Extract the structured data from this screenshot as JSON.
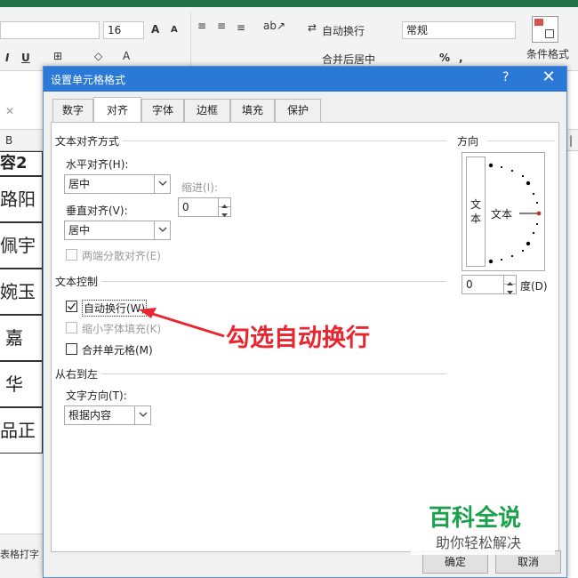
{
  "ribbon": {
    "font_size": "16",
    "wrap_text": "自动换行",
    "number_format": "常规",
    "merge_center": "合并后居中",
    "conditional_format": "条件格式",
    "font_increase": "A",
    "font_decrease": "A",
    "bold": "I",
    "underline": "U",
    "percent": "%",
    "comma": ","
  },
  "sheet": {
    "column_b": "B",
    "header_cell": "容2",
    "cells": [
      "路阳",
      "佩宇",
      "婉玉",
      "嘉",
      "华",
      "品正"
    ],
    "footer_text": "表格打字"
  },
  "dialog": {
    "title": "设置单元格格式",
    "help": "?",
    "close": "✕",
    "tabs": [
      "数字",
      "对齐",
      "字体",
      "边框",
      "填充",
      "保护"
    ],
    "active_tab_index": 1,
    "text_align": {
      "group_label": "文本对齐方式",
      "horizontal_label": "水平对齐(H):",
      "horizontal_value": "居中",
      "indent_label": "缩进(I):",
      "indent_value": "0",
      "vertical_label": "垂直对齐(V):",
      "vertical_value": "居中",
      "justify_distributed": "两端分散对齐(E)"
    },
    "text_control": {
      "group_label": "文本控制",
      "wrap_text": "自动换行(W)",
      "wrap_checked": true,
      "shrink_to_fit": "缩小字体填充(K)",
      "merge_cells": "合并单元格(M)"
    },
    "rtl": {
      "group_label": "从右到左",
      "direction_label": "文字方向(T):",
      "direction_value": "根据内容"
    },
    "orientation": {
      "group_label": "方向",
      "vertical_text": [
        "文",
        "本"
      ],
      "text_label": "文本",
      "degree_value": "0",
      "degree_label": "度(D)"
    },
    "ok_button": "确定",
    "cancel_button": "取消"
  },
  "annotation": {
    "callout": "勾选自动换行",
    "color": "#e8262f"
  },
  "watermark": {
    "main": "百科全说",
    "sub": "助你轻松解决",
    "color": "#19a14b"
  }
}
